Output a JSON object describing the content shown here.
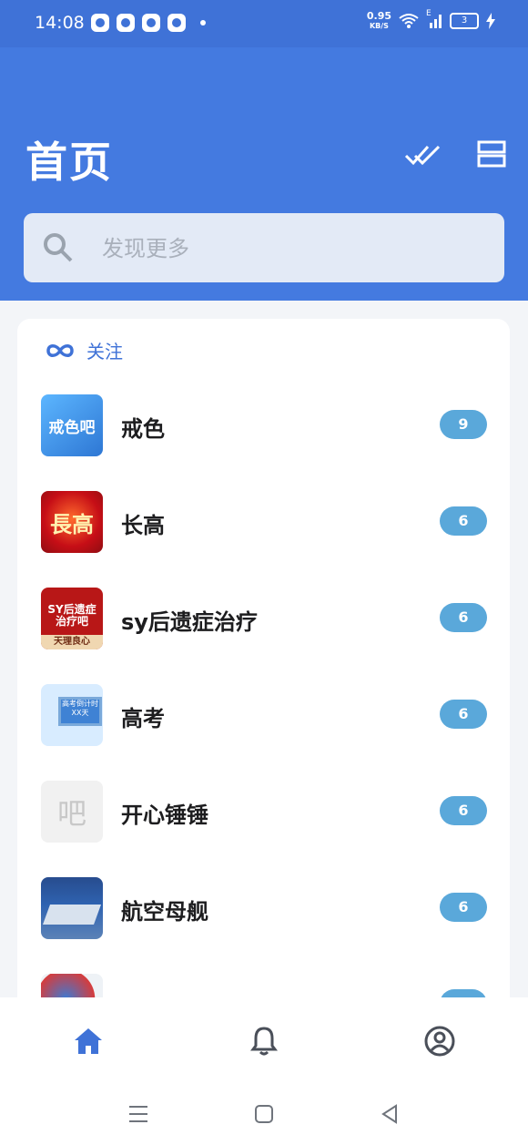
{
  "status_bar": {
    "time": "14:08",
    "net_speed_value": "0.95",
    "net_speed_unit": "KB/S",
    "network_type": "E",
    "battery_level": "3"
  },
  "header": {
    "title": "首页",
    "accent_color": "#447ae0",
    "search_placeholder": "发现更多"
  },
  "follow_section": {
    "title": "关注",
    "forums": [
      {
        "name": "戒色",
        "badge": "9",
        "thumb_text": "戒色吧"
      },
      {
        "name": "长高",
        "badge": "6",
        "thumb_text": "長高"
      },
      {
        "name": "sy后遗症治疗",
        "badge": "6",
        "thumb_text": "SY后遗症治疗吧",
        "thumb_subtext": "天理良心"
      },
      {
        "name": "高考",
        "badge": "6",
        "thumb_text": "高考倒计时 XX天"
      },
      {
        "name": "开心锤锤",
        "badge": "6",
        "thumb_text": "吧"
      },
      {
        "name": "航空母舰",
        "badge": "6",
        "thumb_text": ""
      },
      {
        "name": "",
        "badge": "",
        "thumb_text": ""
      }
    ]
  },
  "tabs": [
    {
      "name": "home",
      "icon": "home-icon",
      "active": true
    },
    {
      "name": "notifications",
      "icon": "bell-icon",
      "active": false
    },
    {
      "name": "profile",
      "icon": "user-icon",
      "active": false
    }
  ],
  "system_nav": [
    "menu-icon",
    "home-square-icon",
    "back-triangle-icon"
  ]
}
